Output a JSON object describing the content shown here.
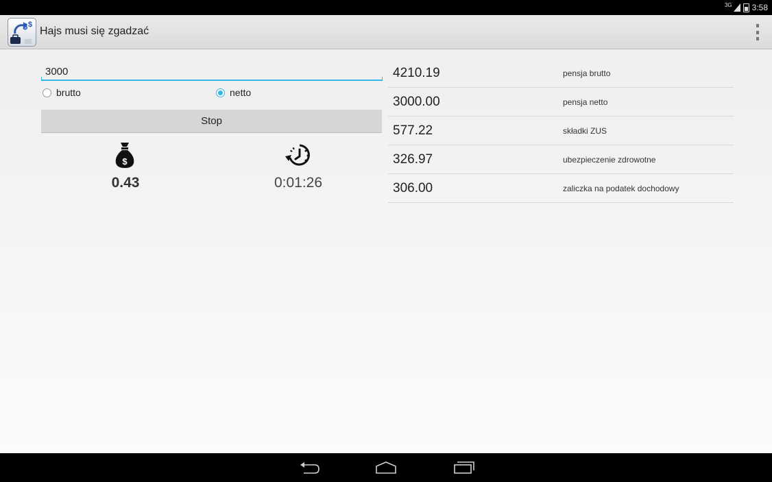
{
  "status_bar": {
    "network": "3G",
    "time": "3:58"
  },
  "app": {
    "title": "Hajs musi się zgadzać"
  },
  "form": {
    "salary_value": "3000",
    "radio_brutto_label": "brutto",
    "radio_netto_label": "netto",
    "selected": "netto",
    "stop_label": "Stop"
  },
  "counters": {
    "earned": "0.43",
    "elapsed": "0:01:26"
  },
  "breakdown": [
    {
      "amount": "4210.19",
      "label": "pensja brutto"
    },
    {
      "amount": "3000.00",
      "label": "pensja netto"
    },
    {
      "amount": "577.22",
      "label": "składki ZUS"
    },
    {
      "amount": "326.97",
      "label": "ubezpieczenie zdrowotne"
    },
    {
      "amount": "306.00",
      "label": "zaliczka na podatek dochodowy"
    }
  ],
  "colors": {
    "accent": "#33b5e5",
    "status_bar": "#000000",
    "action_bar": "#e3e3e3",
    "button": "#d6d6d6"
  },
  "icons": [
    "signal-icon",
    "battery-icon",
    "app-icon",
    "overflow-menu-icon",
    "money-bag-icon",
    "timer-icon",
    "back-icon",
    "home-icon",
    "recents-icon"
  ]
}
